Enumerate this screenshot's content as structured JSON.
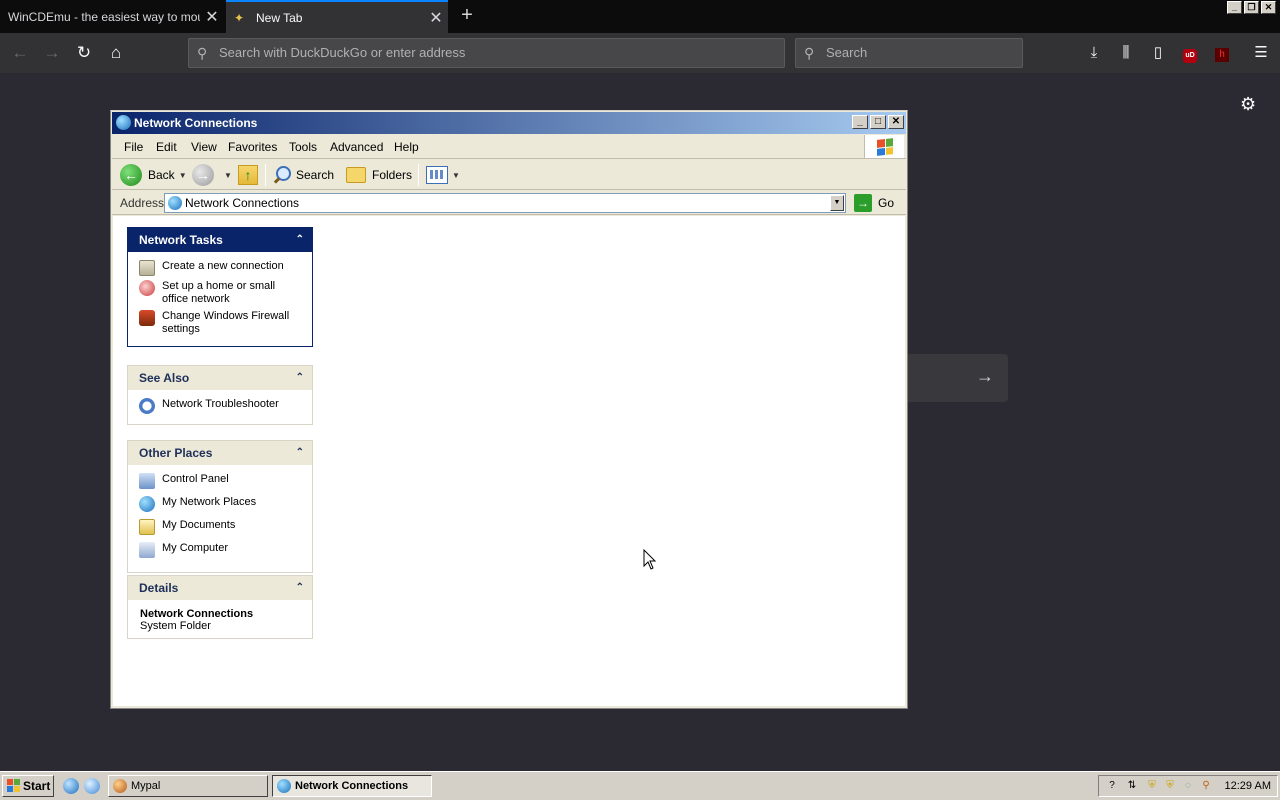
{
  "browser": {
    "tabs": [
      {
        "label": "WinCDEmu - the easiest way to mount",
        "active": false
      },
      {
        "label": "New Tab",
        "active": true
      }
    ],
    "url_placeholder": "Search with DuckDuckGo or enter address",
    "search_placeholder": "Search",
    "ublock_label": "uD",
    "ext_label": "h"
  },
  "window": {
    "title": "Network Connections",
    "menu": [
      "File",
      "Edit",
      "View",
      "Favorites",
      "Tools",
      "Advanced",
      "Help"
    ],
    "toolbar": {
      "back": "Back",
      "search": "Search",
      "folders": "Folders"
    },
    "address": {
      "label": "Address",
      "value": "Network Connections",
      "go": "Go"
    },
    "panes": {
      "network_tasks": {
        "title": "Network Tasks",
        "items": [
          "Create a new connection",
          "Set up a home or small office network",
          "Change Windows Firewall settings"
        ]
      },
      "see_also": {
        "title": "See Also",
        "items": [
          "Network Troubleshooter"
        ]
      },
      "other_places": {
        "title": "Other Places",
        "items": [
          "Control Panel",
          "My Network Places",
          "My Documents",
          "My Computer"
        ]
      },
      "details": {
        "title": "Details",
        "name": "Network Connections",
        "type": "System Folder"
      }
    }
  },
  "taskbar": {
    "start": "Start",
    "tasks": [
      {
        "label": "Mypal",
        "active": false
      },
      {
        "label": "Network Connections",
        "active": true
      }
    ],
    "clock": "12:29 AM"
  },
  "colors": {
    "browser_bg": "#2b2a33",
    "title_gradient_start": "#0a246a",
    "title_gradient_end": "#a6caf0",
    "taskbar": "#d4d0c8"
  }
}
